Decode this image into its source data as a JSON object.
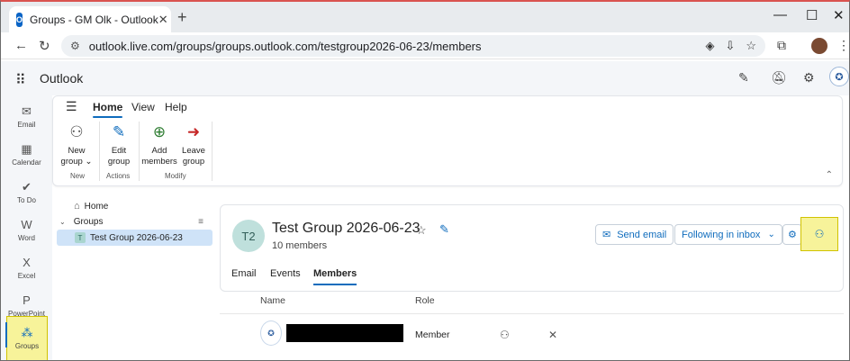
{
  "browser": {
    "tab_title": "Groups - GM Olk - Outlook",
    "tab_icon": "O",
    "new_tab": "+",
    "url": "outlook.live.com/groups/groups.outlook.com/testgroup2026-06-23/members",
    "back": "←",
    "reload": "↻",
    "min": "—",
    "max": "☐",
    "close": "✕"
  },
  "app": {
    "brand": "Outlook",
    "avatar_text": "✪"
  },
  "rail": {
    "items": [
      {
        "label": "Email",
        "icon": "✉"
      },
      {
        "label": "Calendar",
        "icon": "▦"
      },
      {
        "label": "To Do",
        "icon": "✔"
      },
      {
        "label": "Word",
        "icon": "W"
      },
      {
        "label": "Excel",
        "icon": "X"
      },
      {
        "label": "PowerPoint",
        "icon": "P"
      },
      {
        "label": "Groups",
        "icon": "⁂"
      }
    ]
  },
  "ribbon": {
    "tabs": [
      "Home",
      "View",
      "Help"
    ],
    "groups": [
      {
        "name": "New",
        "buttons": [
          {
            "label": "New group ⌄",
            "icon": "⚇"
          }
        ]
      },
      {
        "name": "Actions",
        "buttons": [
          {
            "label": "Edit group",
            "icon": "✎"
          }
        ]
      },
      {
        "name": "Modify",
        "buttons": [
          {
            "label": "Add members",
            "icon": "⊕"
          },
          {
            "label": "Leave group",
            "icon": "➜"
          }
        ]
      }
    ],
    "collapse": "⌃"
  },
  "folder_pane": {
    "home": "Home",
    "groups": "Groups",
    "selected_group": "Test Group 2026-06-23",
    "selected_initial": "T"
  },
  "group": {
    "initials": "T2",
    "title": "Test Group 2026-06-23",
    "star": "☆",
    "edit": "✎",
    "member_count": "10 members",
    "send_email": "Send email",
    "following": "Following in inbox",
    "tabs": [
      "Email",
      "Events",
      "Members"
    ]
  },
  "members": {
    "col_name": "Name",
    "col_role": "Role",
    "rows": [
      {
        "role": "Member"
      }
    ]
  },
  "colors": {
    "accent": "#0f6cbd",
    "highlight": "#f7f39a"
  }
}
